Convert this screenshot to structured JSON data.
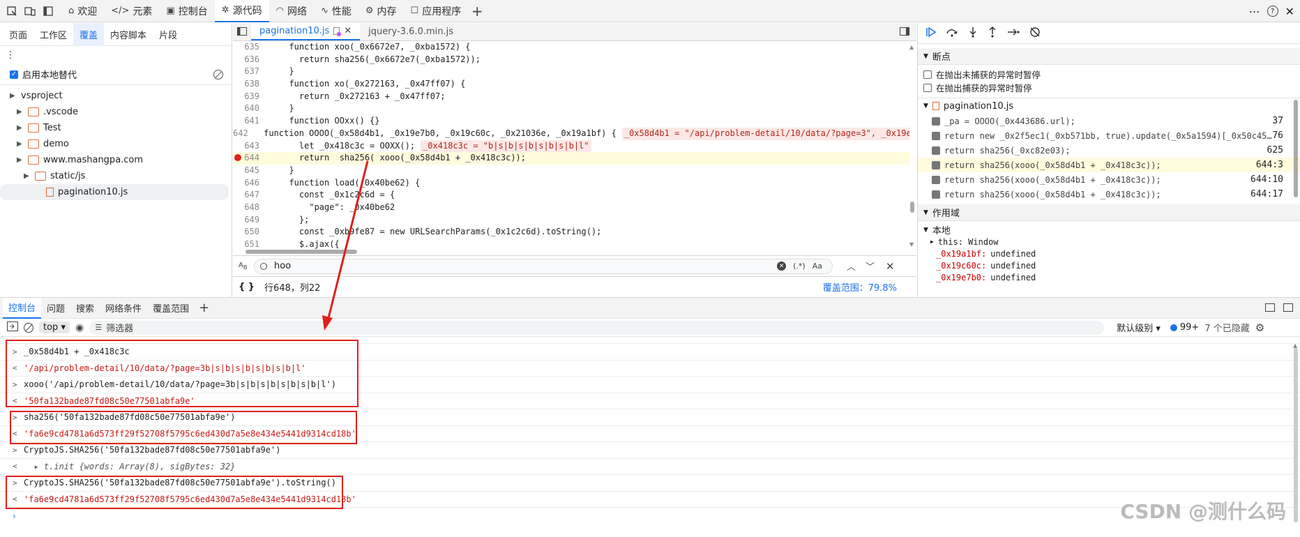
{
  "topbar": {
    "tabs": [
      {
        "label": "欢迎",
        "icon": "home-icon"
      },
      {
        "label": "元素",
        "icon": "code-brackets-icon"
      },
      {
        "label": "控制台",
        "icon": "console-icon"
      },
      {
        "label": "源代码",
        "icon": "bug-icon"
      },
      {
        "label": "网络",
        "icon": "wifi-icon"
      },
      {
        "label": "性能",
        "icon": "performance-icon"
      },
      {
        "label": "内存",
        "icon": "memory-icon"
      },
      {
        "label": "应用程序",
        "icon": "application-icon"
      }
    ]
  },
  "navigator": {
    "tabs": [
      "页面",
      "工作区",
      "覆盖",
      "内容脚本",
      "片段"
    ],
    "override_label": "启用本地替代",
    "tree": [
      "vsproject",
      ".vscode",
      "Test",
      "demo",
      "www.mashangpa.com",
      "static/js",
      "pagination10.js"
    ]
  },
  "editor": {
    "tabs": [
      "pagination10.js",
      "jquery-3.6.0.min.js"
    ],
    "lines": [
      {
        "n": "635",
        "t": "  function xoo(_0x6672e7, _0xba1572) {"
      },
      {
        "n": "636",
        "t": "    return sha256(_0x6672e7(_0xba1572));"
      },
      {
        "n": "637",
        "t": "  }"
      },
      {
        "n": "638",
        "t": "  function xo(_0x272163, _0x47ff07) {"
      },
      {
        "n": "639",
        "t": "    return _0x272163 + _0x47ff07;"
      },
      {
        "n": "640",
        "t": "  }"
      },
      {
        "n": "641",
        "t": "  function OOxx() {}"
      },
      {
        "n": "642",
        "t": "  function OOOO(_0x58d4b1, _0x19e7b0, _0x19c60c, _0x21036e, _0x19a1bf) {",
        "inl": "_0x58d4b1 = \"/api/problem-detail/10/data/?page=3\", _0x19e"
      },
      {
        "n": "643",
        "t": "    let _0x418c3c = OOXX();",
        "inl": "_0x418c3c = \"b|s|b|s|b|s|b|s|b|l\""
      },
      {
        "n": "644",
        "t": "    return  sha256( xooo(_0x58d4b1 + _0x418c3c));",
        "bp": true
      },
      {
        "n": "645",
        "t": "  }"
      },
      {
        "n": "646",
        "t": "  function load(_0x40be62) {"
      },
      {
        "n": "647",
        "t": "    const _0x1c2c6d = {"
      },
      {
        "n": "648",
        "t": "      \"page\": _0x40be62"
      },
      {
        "n": "649",
        "t": "    };"
      },
      {
        "n": "650",
        "t": "    const _0xb9fe87 = new URLSearchParams(_0x1c2c6d).toString();"
      },
      {
        "n": "651",
        "t": "    $.ajax({"
      }
    ],
    "search_value": "hoo",
    "regex_label": "(.*)",
    "case_label": "Aa",
    "position": "行648，列22",
    "coverage": "覆盖范围：79.8%"
  },
  "debugger": {
    "breakpoints_title": "断点",
    "pause_uncaught": "在抛出未捕获的异常时暂停",
    "pause_caught": "在抛出捕获的异常时暂停",
    "file": "pagination10.js",
    "bps": [
      {
        "code": "_pa = OOOO(_0x443686.url);",
        "loc": "37"
      },
      {
        "code": "return new _0x2f5ec1(_0xb571bb, true).update(_0x5a1594)[_0x50c45…",
        "loc": "76"
      },
      {
        "code": "return sha256(_0xc82e03);",
        "loc": "625"
      },
      {
        "code": "return sha256(xooo(_0x58d4b1 + _0x418c3c));",
        "loc": "644:3"
      },
      {
        "code": "return sha256(xooo(_0x58d4b1 + _0x418c3c));",
        "loc": "644:10"
      },
      {
        "code": "return sha256(xooo(_0x58d4b1 + _0x418c3c));",
        "loc": "644:17"
      }
    ],
    "scope_title": "作用域",
    "local": "本地",
    "this_row": "this: Window",
    "vars": [
      {
        "name": "_0x19a1bf:",
        "val": "undefined"
      },
      {
        "name": "_0x19c60c:",
        "val": "undefined"
      },
      {
        "name": "_0x19e7b0:",
        "val": "undefined"
      }
    ]
  },
  "drawer": {
    "tabs": [
      "控制台",
      "问题",
      "搜索",
      "网络条件",
      "覆盖范围"
    ],
    "context": "top",
    "filter_placeholder": "筛选器",
    "level": "默认级别",
    "issues": "99+",
    "hidden": "7 个已隐藏",
    "lines": [
      {
        "p": ">",
        "t": "_0x58d4b1 + _0x418c3c",
        "s": false
      },
      {
        "p": "<",
        "t": "'/api/problem-detail/10/data/?page=3b|s|b|s|b|s|b|s|b|l'",
        "s": true
      },
      {
        "p": ">",
        "t": "xooo('/api/problem-detail/10/data/?page=3b|s|b|s|b|s|b|s|b|l')",
        "s": false
      },
      {
        "p": "<",
        "t": "'50fa132bade87fd08c50e77501abfa9e'",
        "s": true
      },
      {
        "p": ">",
        "t": "sha256('50fa132bade87fd08c50e77501abfa9e')",
        "s": false
      },
      {
        "p": "<",
        "t": "'fa6e9cd4781a6d573ff29f52708f5795c6ed430d7a5e8e434e5441d9314cd18b'",
        "s": true
      },
      {
        "p": ">",
        "t": "CryptoJS.SHA256('50fa132bade87fd08c50e77501abfa9e')",
        "s": false
      },
      {
        "p": "<",
        "t": "  ▸ t.init {words: Array(8), sigBytes: 32}",
        "s": false
      },
      {
        "p": ">",
        "t": "CryptoJS.SHA256('50fa132bade87fd08c50e77501abfa9e').toString()",
        "s": false
      },
      {
        "p": "<",
        "t": "'fa6e9cd4781a6d573ff29f52708f5795c6ed430d7a5e8e434e5441d9314cd18b'",
        "s": true
      }
    ]
  },
  "watermark": "CSDN @测什么码",
  "colors": {
    "accent": "#1a73e8",
    "annotation": "#e0201b"
  }
}
